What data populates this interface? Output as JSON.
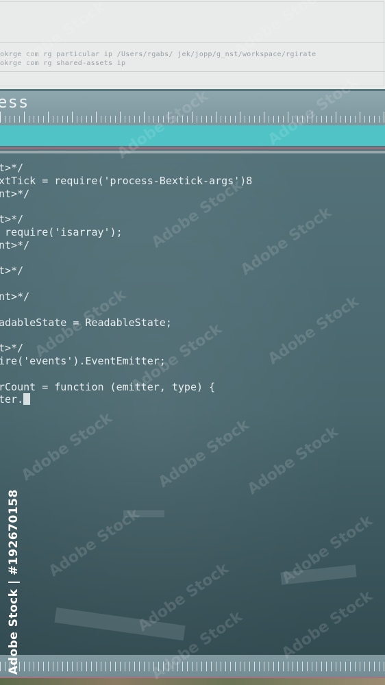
{
  "path_lines": [
    "okrge com rg particular ip /Users/rgabs/ jek/jopp/g_nst/workspace/rgirate",
    "okrge com rg shared-assets ip"
  ],
  "title": "ess",
  "code_lines": [
    {
      "text": "t>*/"
    },
    {
      "text": "xtTick = require('process-Bextick-args')8"
    },
    {
      "text": "nt>*/"
    },
    {
      "text": ""
    },
    {
      "text": "t>*/"
    },
    {
      "text": " require('isarray');"
    },
    {
      "text": "nt>*/"
    },
    {
      "text": ""
    },
    {
      "text": "t>*/"
    },
    {
      "text": ""
    },
    {
      "text": "nt>*/"
    },
    {
      "text": ""
    },
    {
      "text": "adableState = ReadableState;"
    },
    {
      "text": ""
    },
    {
      "text": "t>*/"
    },
    {
      "text": "ire('events').EventEmitter;"
    },
    {
      "text": ""
    },
    {
      "text": "rCount = function (emitter, type) {"
    },
    {
      "text": "ter."
    }
  ],
  "watermark": "Adobe Stock",
  "stock_id": "Adobe Stock | #192670158",
  "colors": {
    "accent": "#4fc3c6",
    "title_bar": "#8ea6ad",
    "code_text": "#e7eeef"
  }
}
